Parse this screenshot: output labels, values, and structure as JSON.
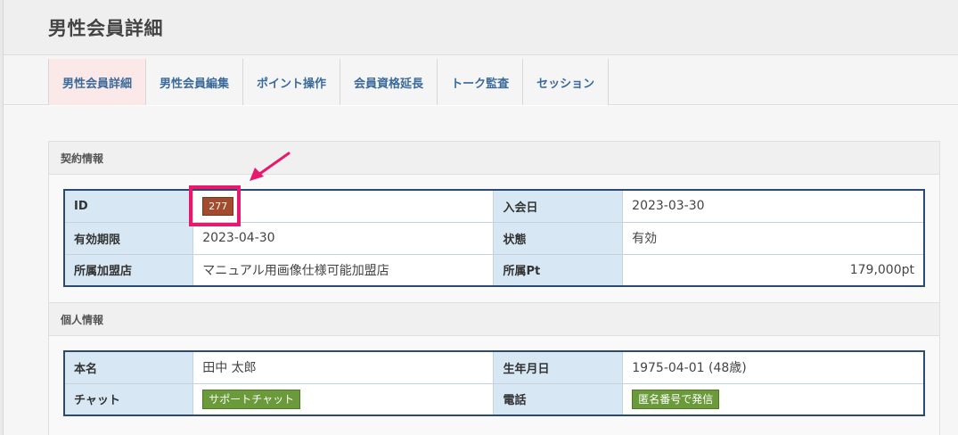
{
  "header": {
    "title": "男性会員詳細"
  },
  "tabs": [
    {
      "label": "男性会員詳細",
      "active": true
    },
    {
      "label": "男性会員編集",
      "active": false
    },
    {
      "label": "ポイント操作",
      "active": false
    },
    {
      "label": "会員資格延長",
      "active": false
    },
    {
      "label": "トーク監査",
      "active": false
    },
    {
      "label": "セッション",
      "active": false
    }
  ],
  "contract": {
    "title": "契約情報",
    "id_label": "ID",
    "id_value": "277",
    "join_label": "入会日",
    "join_value": "2023-03-30",
    "expire_label": "有効期限",
    "expire_value": "2023-04-30",
    "status_label": "状態",
    "status_value": "有効",
    "store_label": "所属加盟店",
    "store_value": "マニュアル用画像仕様可能加盟店",
    "pt_label": "所属Pt",
    "pt_value": "179,000pt"
  },
  "personal": {
    "title": "個人情報",
    "name_label": "本名",
    "name_value": "田中 太郎",
    "birth_label": "生年月日",
    "birth_value": "1975-04-01 (48歳)",
    "chat_label": "チャット",
    "chat_button": "サポートチャット",
    "phone_label": "電話",
    "phone_button": "匿名番号で発信"
  },
  "colors": {
    "accent_highlight": "#e8186f",
    "label_bg": "#d7e8f4",
    "id_badge": "#a24b2d",
    "button_green": "#6a9a3a",
    "tab_text": "#3a6a9c"
  }
}
